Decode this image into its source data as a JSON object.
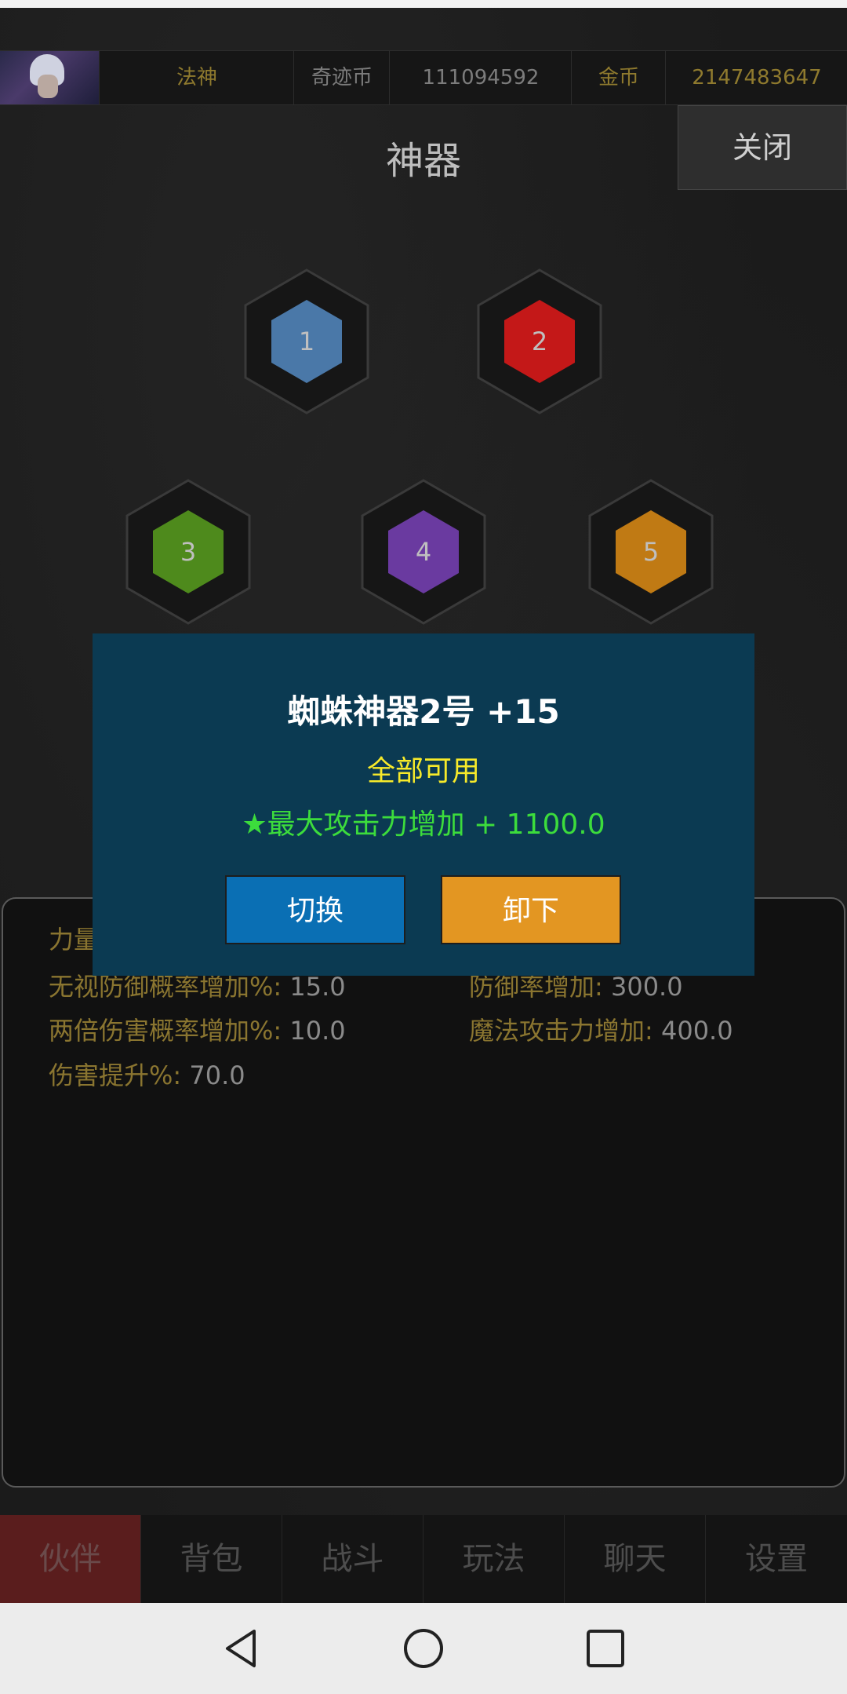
{
  "header": {
    "class_name": "法神",
    "currency1_label": "奇迹币",
    "currency1_value": "111094592",
    "currency2_label": "金币",
    "currency2_value": "2147483647"
  },
  "page": {
    "title": "神器",
    "close_label": "关闭"
  },
  "slots": [
    {
      "num": "1",
      "color": "#4a78a8"
    },
    {
      "num": "2",
      "color": "#c41818"
    },
    {
      "num": "3",
      "color": "#4e8a1c"
    },
    {
      "num": "4",
      "color": "#6a3aa0"
    },
    {
      "num": "5",
      "color": "#c07a14"
    }
  ],
  "stats": [
    {
      "label": "力量",
      "value": ""
    },
    {
      "label": "无视防御概率增加%:",
      "value": "15.0"
    },
    {
      "label": "防御率增加:",
      "value": "300.0"
    },
    {
      "label": "两倍伤害概率增加%:",
      "value": "10.0"
    },
    {
      "label": "魔法攻击力增加:",
      "value": "400.0"
    },
    {
      "label": "伤害提升%:",
      "value": "70.0"
    }
  ],
  "dialog": {
    "title": "蜘蛛神器2号 +15",
    "subtitle": "全部可用",
    "attribute": "★最大攻击力增加 + 1100.0",
    "switch_label": "切换",
    "unload_label": "卸下"
  },
  "nav": [
    {
      "label": "伙伴"
    },
    {
      "label": "背包"
    },
    {
      "label": "战斗"
    },
    {
      "label": "玩法"
    },
    {
      "label": "聊天"
    },
    {
      "label": "设置"
    }
  ]
}
